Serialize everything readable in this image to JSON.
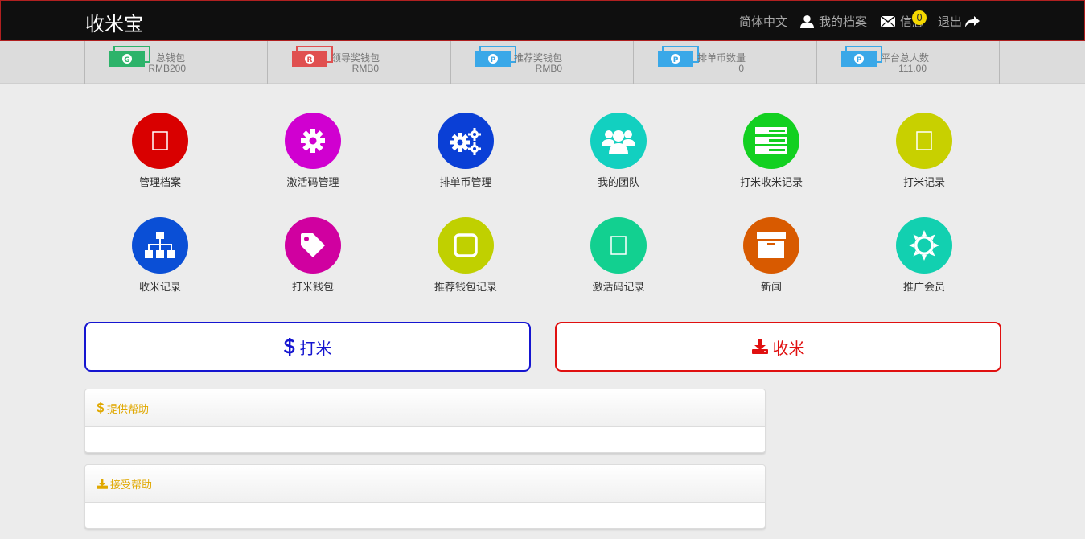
{
  "header": {
    "brand": "收米宝",
    "language": "简体中文",
    "profile": "我的档案",
    "messages": "信息",
    "messages_count": "0",
    "logout": "退出"
  },
  "stats": [
    {
      "label": "总钱包",
      "value": "RMB200",
      "color": "#2db36a",
      "letter": "G"
    },
    {
      "label": "领导奖钱包",
      "value": "RMB0",
      "color": "#e05050",
      "letter": "R"
    },
    {
      "label": "推荐奖钱包",
      "value": "RMB0",
      "color": "#3aa8e8",
      "letter": "P"
    },
    {
      "label": "排单币数量",
      "value": "0",
      "color": "#3aa8e8",
      "letter": "P"
    },
    {
      "label": "平台总人数",
      "value": "111.00",
      "color": "#3aa8e8",
      "letter": "P"
    }
  ],
  "tiles": [
    {
      "label": "管理档案",
      "color": "#d90000",
      "icon": "placeholder-icon"
    },
    {
      "label": "激活码管理",
      "color": "#d000d0",
      "icon": "gear-icon"
    },
    {
      "label": "排单币管理",
      "color": "#0a3fd6",
      "icon": "gears-icon"
    },
    {
      "label": "我的团队",
      "color": "#12d0c0",
      "icon": "users-icon"
    },
    {
      "label": "打米收米记录",
      "color": "#12d020",
      "icon": "server-icon"
    },
    {
      "label": "打米记录",
      "color": "#c8d000",
      "icon": "placeholder-icon"
    },
    {
      "label": "收米记录",
      "color": "#0a4fd6",
      "icon": "sitemap-icon"
    },
    {
      "label": "打米钱包",
      "color": "#d000a0",
      "icon": "tag-icon"
    },
    {
      "label": "推荐钱包记录",
      "color": "#c0d000",
      "icon": "square-icon"
    },
    {
      "label": "激活码记录",
      "color": "#12d090",
      "icon": "placeholder-icon"
    },
    {
      "label": "新闻",
      "color": "#d85a00",
      "icon": "archive-icon"
    },
    {
      "label": "推广会员",
      "color": "#12d0b0",
      "icon": "sun-icon"
    }
  ],
  "actions": {
    "give": "打米",
    "receive": "收米",
    "give_color": "#1515d0",
    "receive_color": "#e01010"
  },
  "panels": {
    "provide_help": "提供帮助",
    "accept_help": "接受帮助"
  }
}
